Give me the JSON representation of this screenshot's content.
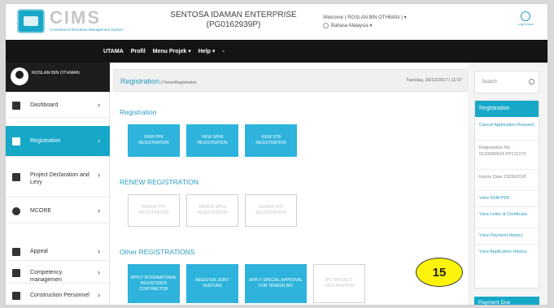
{
  "header": {
    "brand": "CIMS",
    "tagline": "Centralized Information Management System",
    "company_name": "SENTOSA IDAMAN ENTERPRISE",
    "company_id": "(PG0162939P)",
    "welcome": "Welcome ( ROSLAN BIN OTHMAN ) ▾",
    "language": "Bahasa Malaysia ▾",
    "logout": "Log Keluar"
  },
  "nav": {
    "items": [
      "UTAMA",
      "Profil",
      "Menu Projek ▾",
      "Help ▾",
      "-"
    ]
  },
  "user": {
    "name": "ROSLAN BIN OTHMAN"
  },
  "sidebar": {
    "items": [
      {
        "label": "Dashboard",
        "icon": "dashboard-icon"
      },
      {
        "label": "Registration",
        "icon": "edit-icon"
      },
      {
        "label": "Project Declaration and Levy",
        "icon": "folder-icon"
      },
      {
        "label": "MCORE",
        "icon": "gear-icon"
      },
      {
        "label": "Appeal",
        "icon": "scale-icon"
      },
      {
        "label": "Competency managemen",
        "icon": "clipboard-icon"
      },
      {
        "label": "Construction Personnel",
        "icon": "id-card-icon"
      }
    ]
  },
  "main": {
    "title": "Registration",
    "breadcrumb": " | Home\\Registration",
    "datetime": "Tuesday, 26/12/2017 | 11:07",
    "sections": [
      {
        "title": "Registration",
        "tiles": [
          "VIEW PPK REGISTRATION",
          "VIEW SPKK REGISTRATION",
          "VIEW STB REGISTRATION"
        ]
      },
      {
        "title": "RENEW REGISTRATION",
        "tiles": [
          "RENEW PPK REGISTRATION",
          "RENEW SPKK REGISTRATION",
          "RENEW STB REGISTRATION"
        ]
      },
      {
        "title": "Other REGISTRATIONS",
        "tiles": [
          "APPLY INTERNATIONAL REGISTERED CONTRACTOR",
          "REGISTER JOINT VENTURE",
          "APPLY SPECIAL APPROVAL FOR TENDER BID",
          "IPC PROJECT DECLARATION"
        ]
      }
    ]
  },
  "right": {
    "search_placeholder": "Search",
    "panel_title": "Registration",
    "cancel": "Cancel Application Request",
    "reg_no": "Registration No. 0120080924-PP121170",
    "expiry": "Expiry Date 23/09/2018",
    "view_ssm": "View SSM PDF",
    "view_letter": "View Letter & Certificate",
    "view_payment": "View Payment History",
    "view_app": "View Application History",
    "payment_due": "Payment Due"
  },
  "annotation": {
    "number": "15"
  }
}
